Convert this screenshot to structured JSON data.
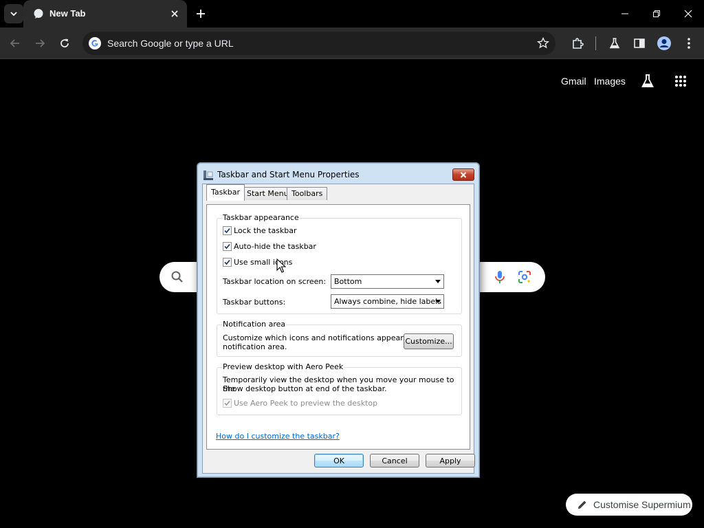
{
  "browser": {
    "tab_title": "New Tab",
    "omnibox_placeholder": "Search Google or type a URL"
  },
  "ntp": {
    "gmail_link": "Gmail",
    "images_link": "Images",
    "customise_label": "Customise Supermium"
  },
  "dialog": {
    "title": "Taskbar and Start Menu Properties",
    "tabs": [
      "Taskbar",
      "Start Menu",
      "Toolbars"
    ],
    "appearance": {
      "title": "Taskbar appearance",
      "lock": "Lock the taskbar",
      "autohide": "Auto-hide the taskbar",
      "small_icons": "Use small icons",
      "location_label": "Taskbar location on screen:",
      "location_value": "Bottom",
      "buttons_label": "Taskbar buttons:",
      "buttons_value": "Always combine, hide labels"
    },
    "notification": {
      "title": "Notification area",
      "line1": "Customize which icons and notifications appear in the",
      "line2": "notification area.",
      "customize_button": "Customize..."
    },
    "peek": {
      "title": "Preview desktop with Aero Peek",
      "line1": "Temporarily view the desktop when you move your mouse to the",
      "line2": "Show desktop button at end of the taskbar.",
      "checkbox": "Use Aero Peek to preview the desktop"
    },
    "help_link": "How do I customize the taskbar?",
    "buttons": {
      "ok": "OK",
      "cancel": "Cancel",
      "apply": "Apply"
    },
    "checked": {
      "lock": true,
      "autohide": true,
      "small_icons": true,
      "aero_peek": true
    }
  }
}
